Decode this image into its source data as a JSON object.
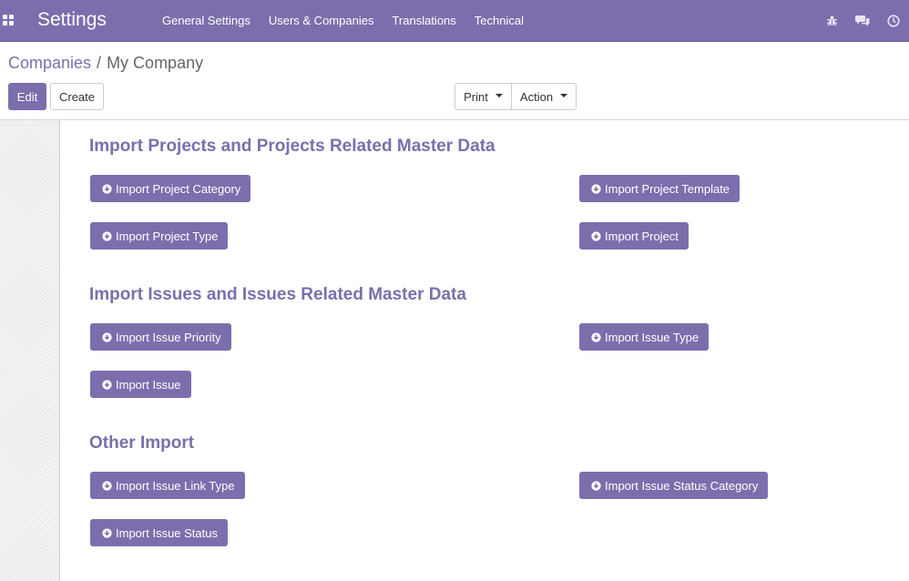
{
  "navbar": {
    "brand": "Settings",
    "menu": [
      "General Settings",
      "Users & Companies",
      "Translations",
      "Technical"
    ]
  },
  "breadcrumb": {
    "parent": "Companies",
    "separator": "/",
    "current": "My Company"
  },
  "buttons": {
    "edit": "Edit",
    "create": "Create",
    "print": "Print",
    "action": "Action"
  },
  "sections": [
    {
      "title": "Import Projects and Projects Related Master Data"
    },
    {
      "title": "Import Issues and Issues Related Master Data"
    },
    {
      "title": "Other Import"
    }
  ],
  "import_buttons": [
    "Import Project Category",
    "Import Project Template",
    "Import Project Type",
    "Import Project",
    "Import Issue Priority",
    "Import Issue Type",
    "Import Issue",
    "Import Issue Link Type",
    "Import Issue Status Category",
    "Import Issue Status"
  ],
  "colors": {
    "brand": "#7c6ead",
    "navbar": "#7c6ead"
  },
  "icons": {
    "apps": "apps-grid-icon",
    "debug": "bug-icon",
    "chat": "chat-icon",
    "activity": "clock-icon",
    "download": "arrow-circle-down-icon"
  }
}
